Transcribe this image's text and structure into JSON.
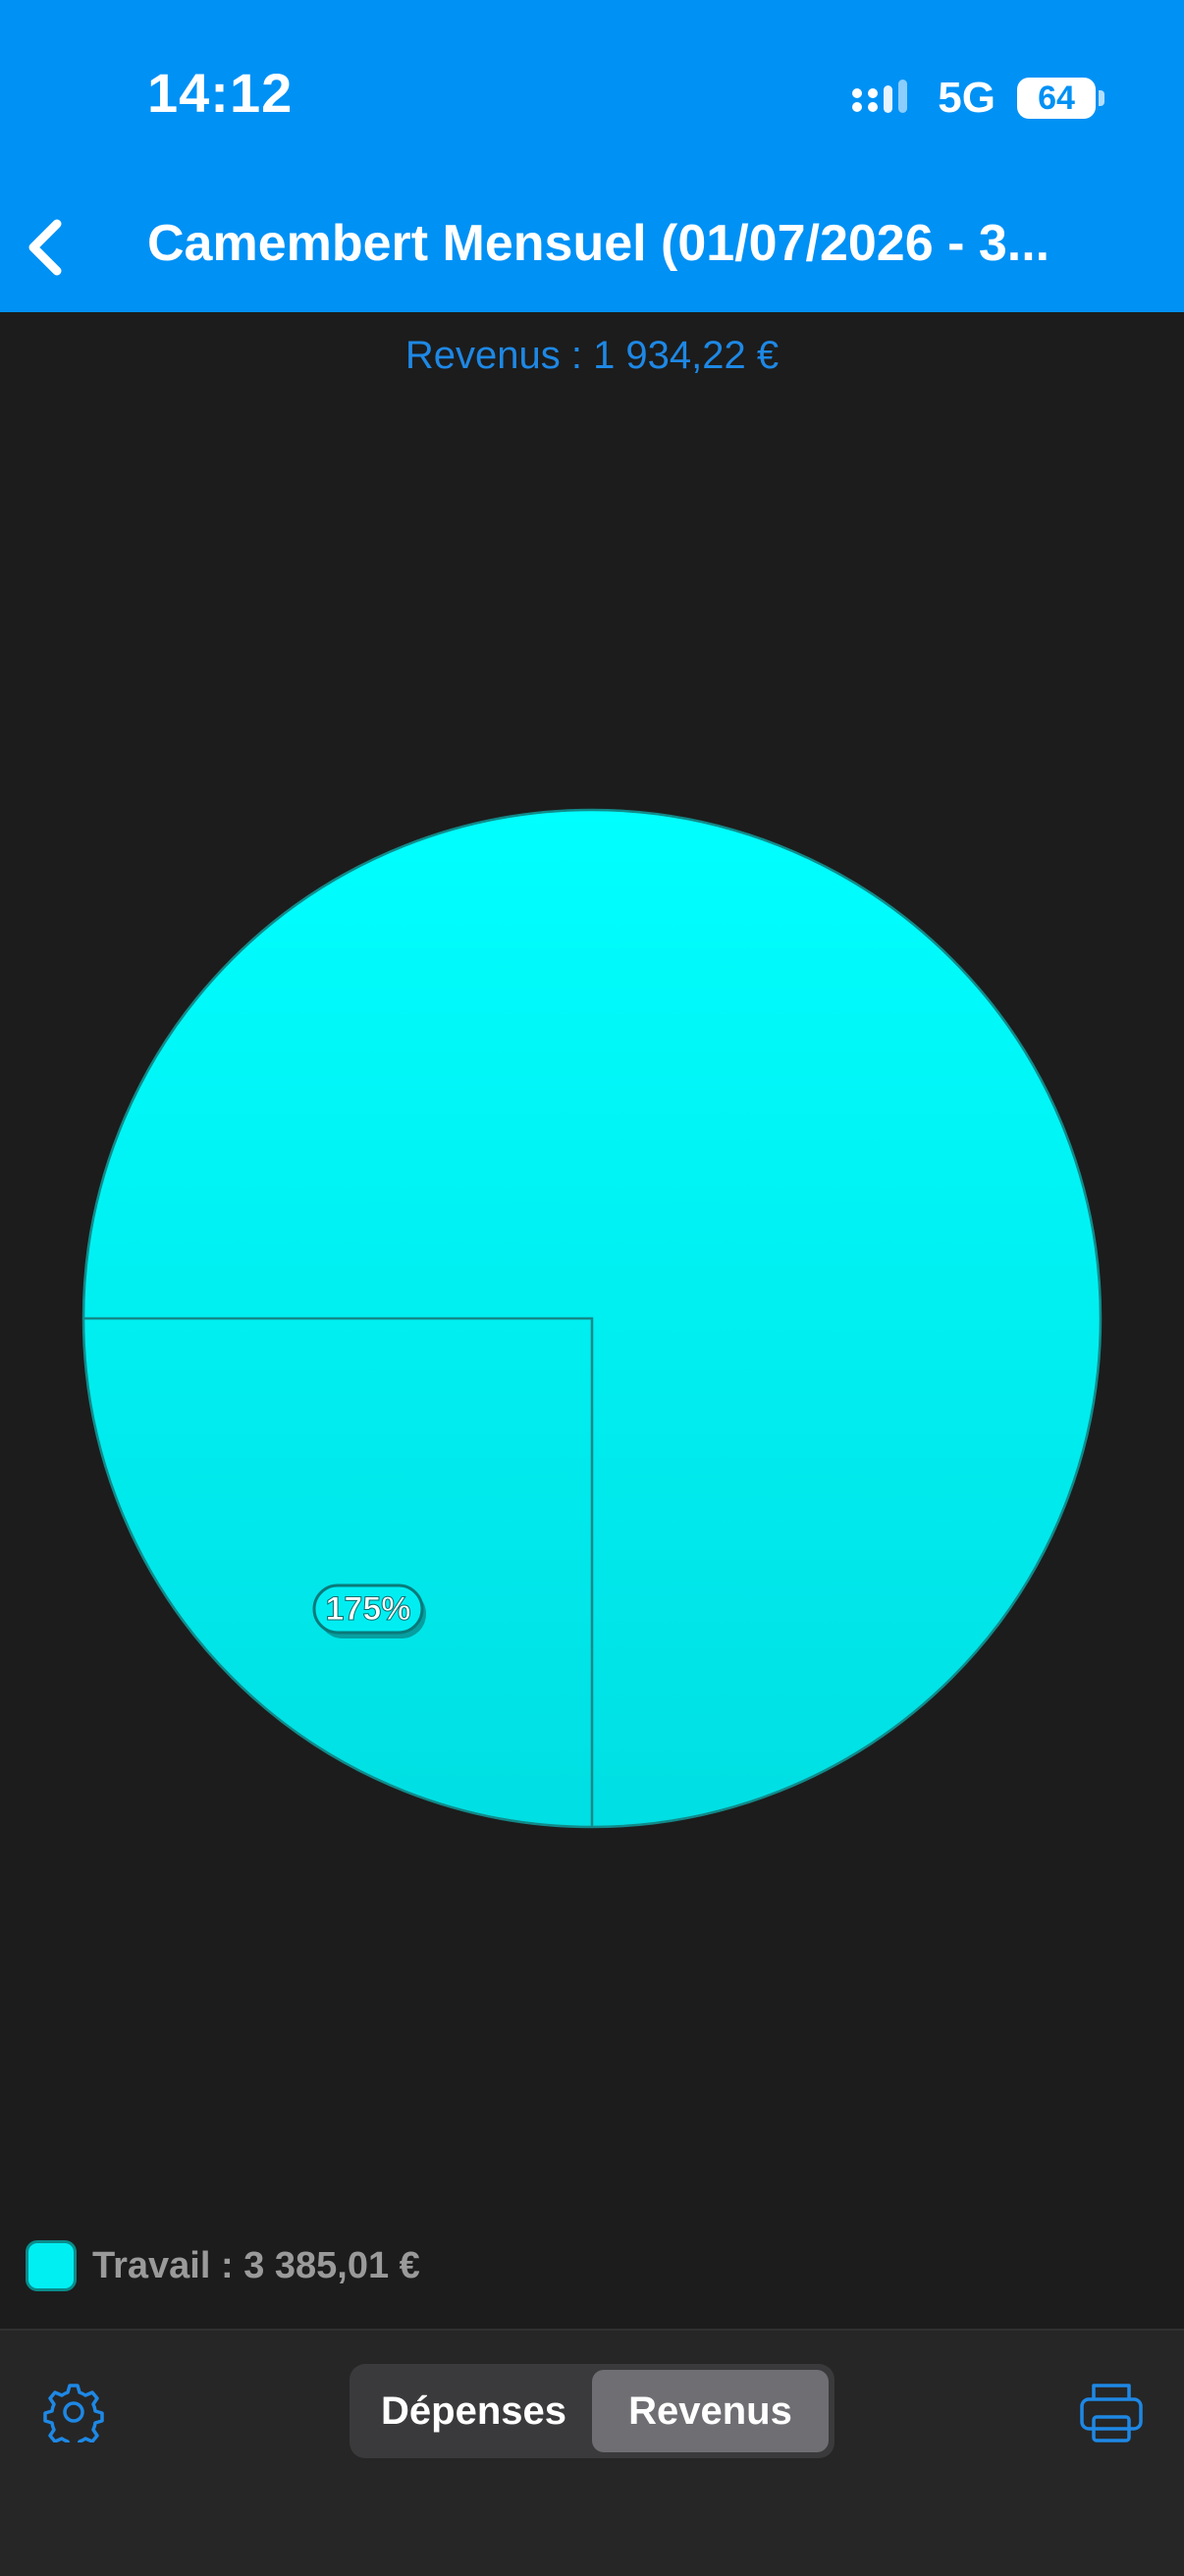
{
  "status_bar": {
    "time": "14:12",
    "network": "5G",
    "battery": "64"
  },
  "header": {
    "title": "Camembert Mensuel (01/07/2026 - 3..."
  },
  "summary": "Revenus : 1  934,22 €",
  "chart_data": {
    "type": "pie",
    "slices": [
      {
        "label": "Travail",
        "value": 3385.01,
        "percent_label": "175%",
        "color": "#00eff3"
      }
    ],
    "title": ""
  },
  "legend": [
    {
      "text": "Travail : 3 385,01 €",
      "color": "#00eff3"
    }
  ],
  "toolbar": {
    "segments": [
      {
        "label": "Dépenses",
        "active": false
      },
      {
        "label": "Revenus",
        "active": true
      }
    ]
  },
  "colors": {
    "header_bg": "#0091f5",
    "accent": "#1e88e5",
    "background": "#1c1c1c",
    "slice": "#00eff3"
  }
}
